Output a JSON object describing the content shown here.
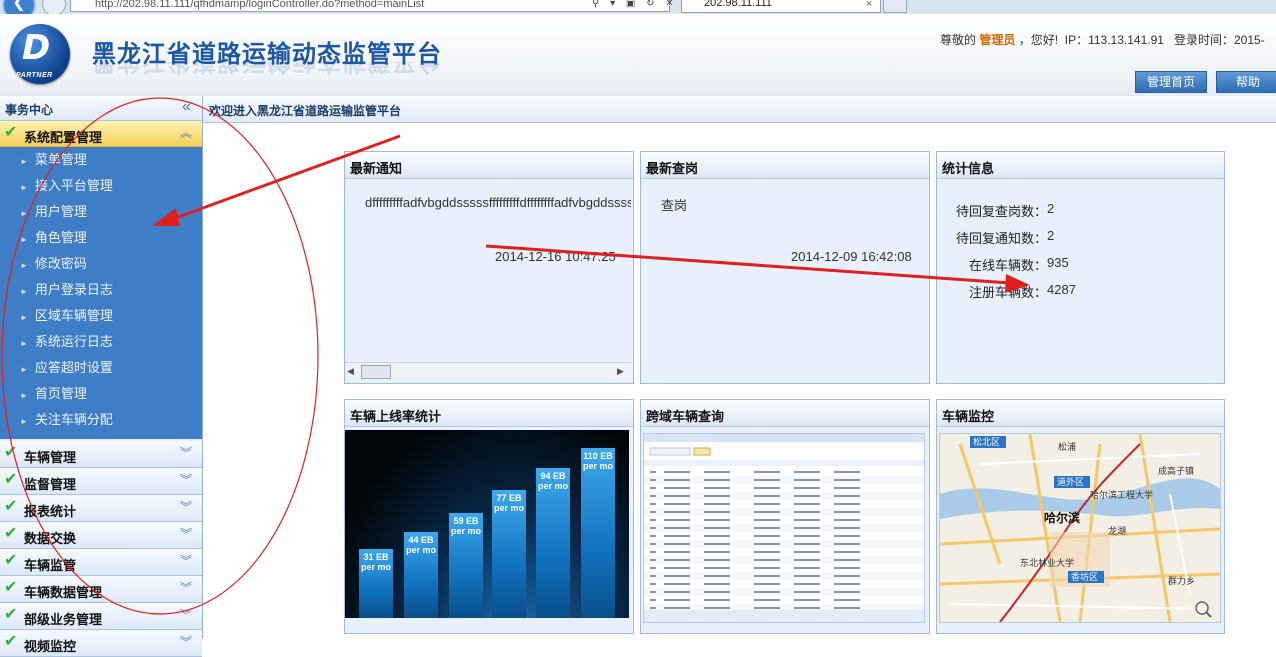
{
  "browser": {
    "address": "http://202.98.11.111/qfhdmamp/loginController.do?method=mainList",
    "tab_title": "202.98.11.111",
    "back_glyph": "❮"
  },
  "header": {
    "title": "黑龙江省道路运输动态监管平台",
    "logo_letter": "D",
    "logo_text": "PARTNER",
    "greeting_prefix": "尊敬的",
    "role": "管理员",
    "greeting_suffix": "，您好!",
    "ip_label": "IP：",
    "ip": "113.13.141.91",
    "login_time_label": "登录时间：",
    "login_time": "2015-",
    "home_button": "管理首页",
    "help_button": "帮助"
  },
  "sidebar": {
    "title": "事务中心",
    "collapse_glyph": "«",
    "active_group": "系统配置管理",
    "sub_items": [
      "菜单管理",
      "接入平台管理",
      "用户管理",
      "角色管理",
      "修改密码",
      "用户登录日志",
      "区域车辆管理",
      "系统运行日志",
      "应答超时设置",
      "首页管理",
      "关注车辆分配"
    ],
    "groups": [
      "车辆管理",
      "监督管理",
      "报表统计",
      "数据交换",
      "车辆监管",
      "车辆数据管理",
      "部级业务管理",
      "视频监控"
    ]
  },
  "main": {
    "welcome": "欢迎进入黑龙江省道路运输监管平台",
    "notice": {
      "title": "最新通知",
      "text": "dfffffffffadfvbgddsssssfffffffffdffffffffadfvbgddssssssfffff",
      "time": "2014-12-16 10:47:25"
    },
    "query": {
      "title": "最新查岗",
      "text": "查岗",
      "time": "2014-12-09 16:42:08"
    },
    "stats": {
      "title": "统计信息",
      "rows": [
        {
          "label": "待回复查岗数：",
          "value": "2"
        },
        {
          "label": "待回复通知数：",
          "value": "2"
        },
        {
          "label": "在线车辆数：",
          "value": "935"
        },
        {
          "label": "注册车辆数：",
          "value": "4287"
        }
      ]
    },
    "rate": {
      "title": "车辆上线率统计",
      "bars": [
        {
          "label": "31 EB",
          "sub": "per mo",
          "value": 31
        },
        {
          "label": "44 EB",
          "sub": "per mo",
          "value": 44
        },
        {
          "label": "59 EB",
          "sub": "per mo",
          "value": 59
        },
        {
          "label": "77 EB",
          "sub": "per mo",
          "value": 77
        },
        {
          "label": "94 EB",
          "sub": "per mo",
          "value": 94
        },
        {
          "label": "110 EB",
          "sub": "per mo",
          "value": 110
        }
      ]
    },
    "cross": {
      "title": "跨域车辆查询"
    },
    "monitor": {
      "title": "车辆监控",
      "map_labels": [
        "松北区",
        "松浦",
        "道外区",
        "哈尔滨工程大学",
        "哈尔滨",
        "香坊区",
        "东北林业大学",
        "群力乡",
        "龙湖",
        "成高子镇"
      ]
    }
  },
  "colors": {
    "brand_blue": "#1b57a6",
    "menu_blue": "#3f7ec6",
    "active_yellow": "#f5cf5a",
    "annotation_red": "#e02020"
  }
}
